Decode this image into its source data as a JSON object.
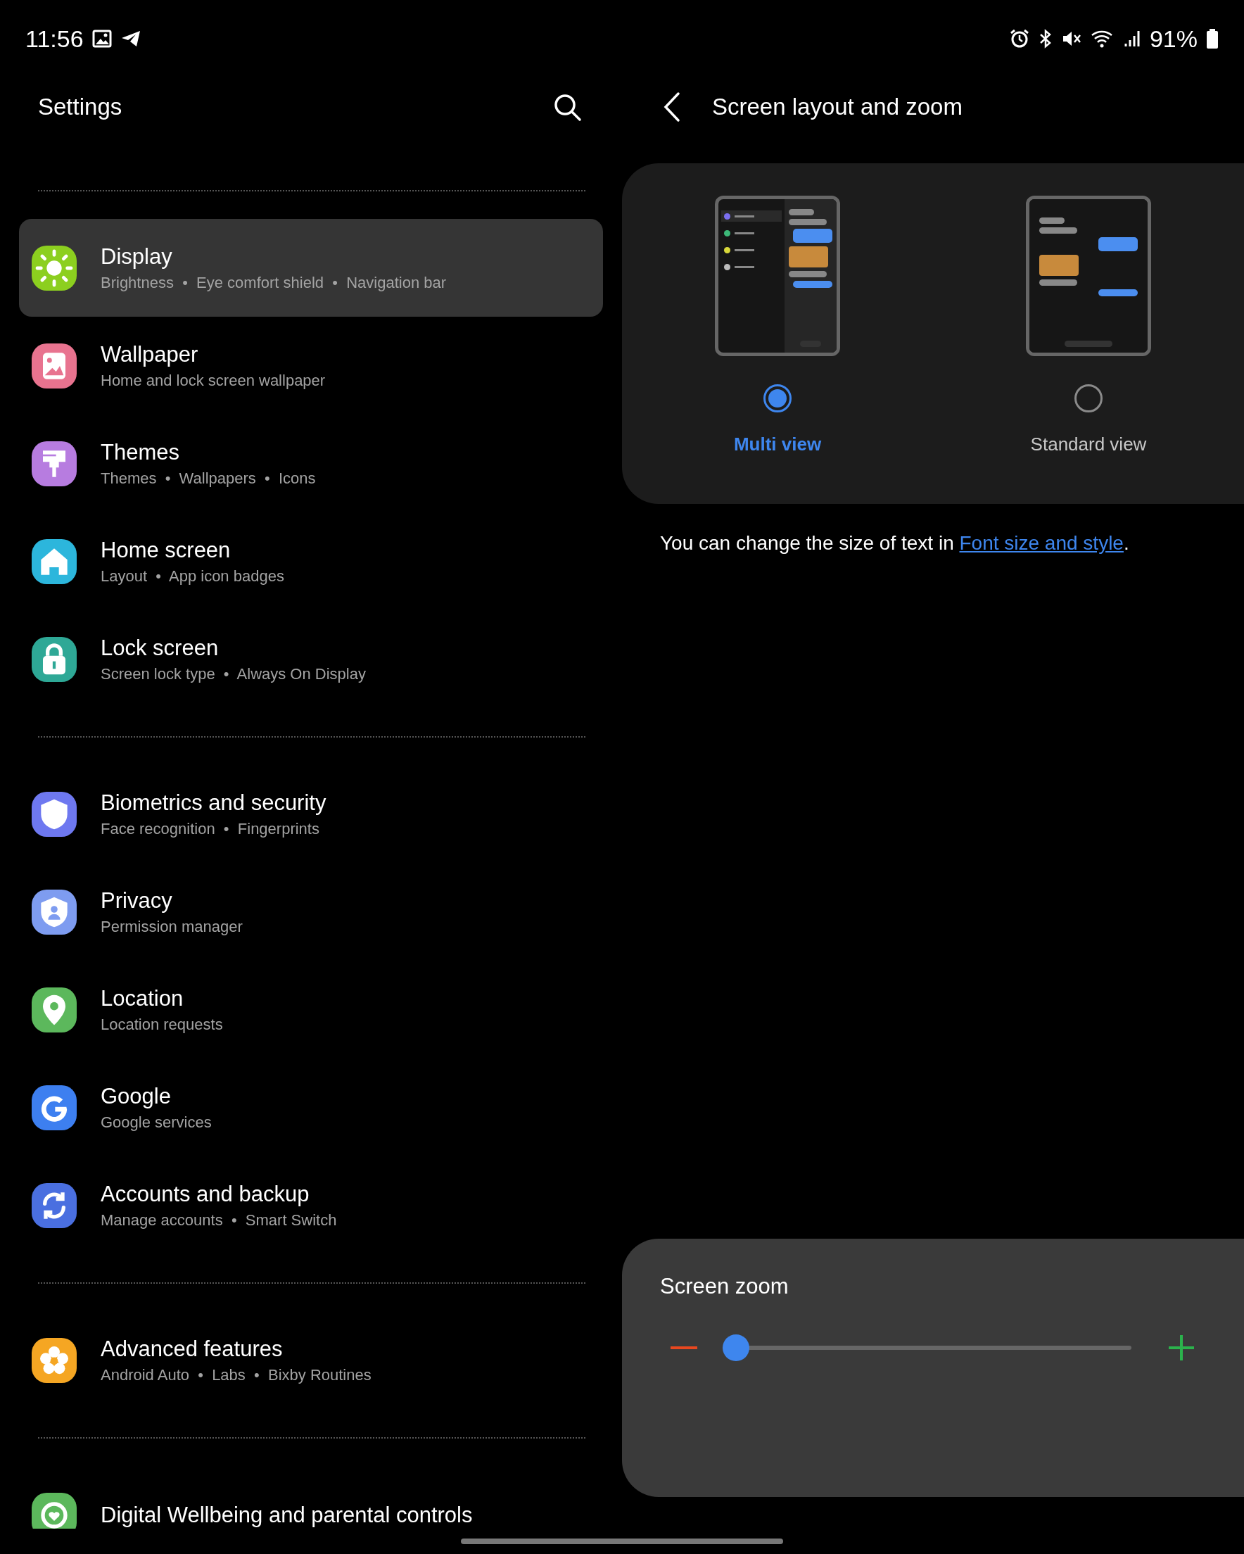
{
  "status_bar": {
    "time": "11:56",
    "battery": "91%"
  },
  "settings": {
    "title": "Settings",
    "sections": [
      {
        "items": [
          {
            "title": "Display",
            "subtitle": "Brightness  •  Eye comfort shield  •  Navigation bar",
            "color": "#8ccf1f",
            "selected": true
          },
          {
            "title": "Wallpaper",
            "subtitle": "Home and lock screen wallpaper",
            "color": "#e8738f",
            "selected": false
          },
          {
            "title": "Themes",
            "subtitle": "Themes  •  Wallpapers  •  Icons",
            "color": "#b77ce0",
            "selected": false
          },
          {
            "title": "Home screen",
            "subtitle": "Layout  •  App icon badges",
            "color": "#2cb6dc",
            "selected": false
          },
          {
            "title": "Lock screen",
            "subtitle": "Screen lock type  •  Always On Display",
            "color": "#2ea896",
            "selected": false
          }
        ]
      },
      {
        "items": [
          {
            "title": "Biometrics and security",
            "subtitle": "Face recognition  •  Fingerprints",
            "color": "#6e78f0",
            "selected": false
          },
          {
            "title": "Privacy",
            "subtitle": "Permission manager",
            "color": "#7e9cf0",
            "selected": false
          },
          {
            "title": "Location",
            "subtitle": "Location requests",
            "color": "#5cb85c",
            "selected": false
          },
          {
            "title": "Google",
            "subtitle": "Google services",
            "color": "#3d7ff0",
            "selected": false
          },
          {
            "title": "Accounts and backup",
            "subtitle": "Manage accounts  •  Smart Switch",
            "color": "#4a6fe0",
            "selected": false
          }
        ]
      },
      {
        "items": [
          {
            "title": "Advanced features",
            "subtitle": "Android Auto  •  Labs  •  Bixby Routines",
            "color": "#f5a623",
            "selected": false
          }
        ]
      },
      {
        "items": [
          {
            "title": "Digital Wellbeing and parental controls",
            "color": "#5cb85c",
            "selected": false
          }
        ]
      }
    ]
  },
  "detail": {
    "title": "Screen layout and zoom",
    "views": [
      {
        "label": "Multi view",
        "selected": true
      },
      {
        "label": "Standard view",
        "selected": false
      }
    ],
    "note": {
      "text": "You can change the size of text in ",
      "link": "Font size and style",
      "end": "."
    },
    "screen_zoom": {
      "title": "Screen zoom",
      "level": 0.0
    }
  }
}
